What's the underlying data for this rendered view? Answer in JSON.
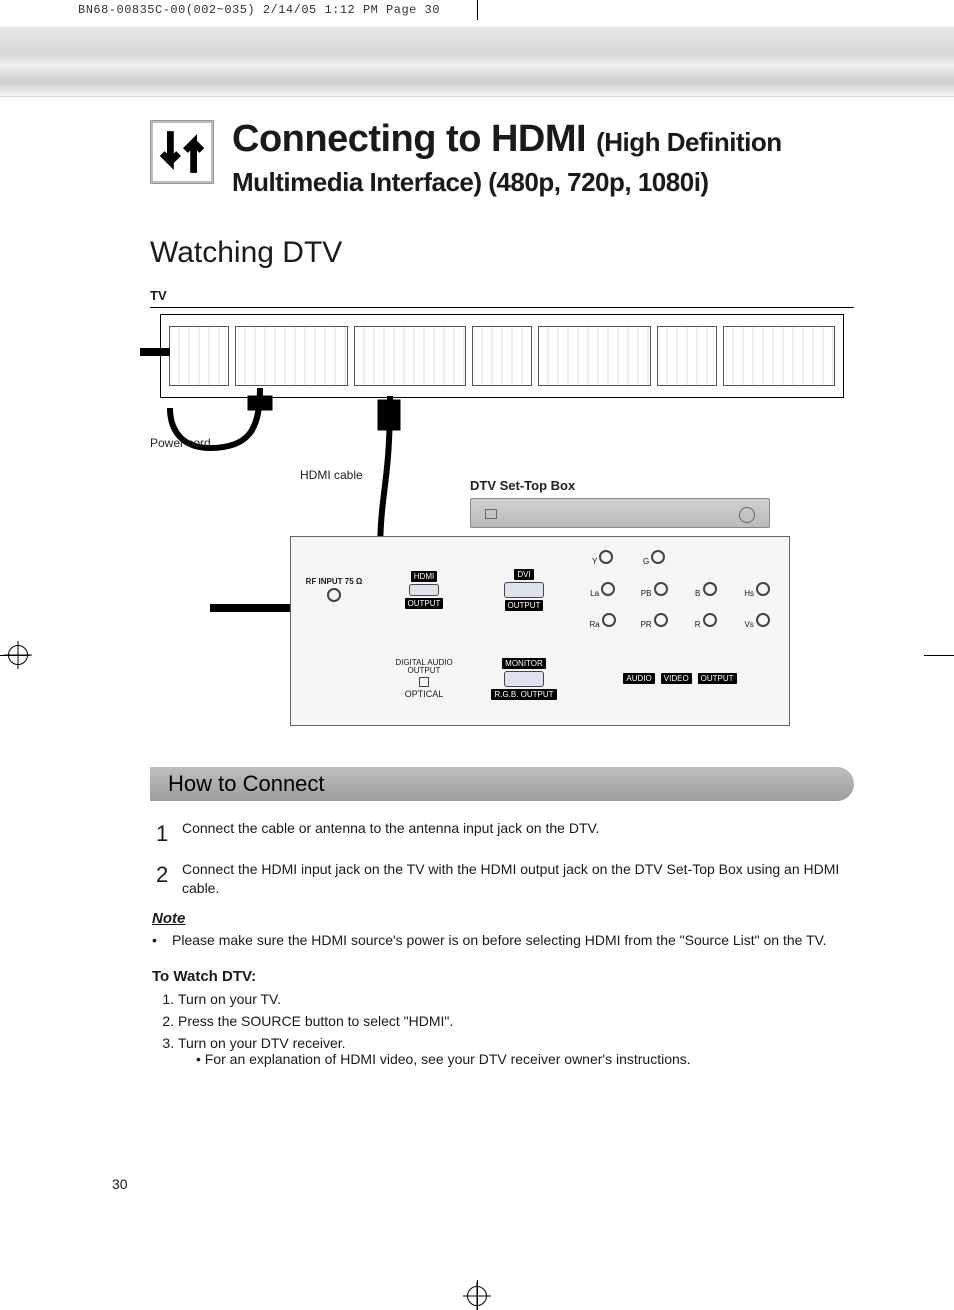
{
  "header_line": "BN68-00835C-00(002~035)  2/14/05  1:12 PM  Page 30",
  "title_main": "Connecting to HDMI",
  "title_sub": "(High Definition Multimedia Interface) (480p, 720p, 1080i)",
  "section_heading": "Watching DTV",
  "labels": {
    "tv": "TV",
    "power_cord": "Power cord",
    "hdmi_cable": "HDMI cable",
    "stb": "DTV Set-Top Box"
  },
  "stb_panel": {
    "rf": "RF INPUT 75 Ω",
    "hdmi": "HDMI",
    "output": "OUTPUT",
    "digital_audio": "DIGITAL AUDIO OUTPUT",
    "optical": "OPTICAL",
    "dvi": "DVI",
    "monitor": "MONITOR",
    "rgb_out": "R.G.B. OUTPUT",
    "audio": "AUDIO",
    "video": "VIDEO",
    "output2": "OUTPUT",
    "jacks": {
      "Y": "Y",
      "Pb": "PB",
      "Pr": "PR",
      "G": "G",
      "B": "B",
      "R": "R",
      "Hs": "Hs",
      "Vs": "Vs",
      "La": "La",
      "Ra": "Ra"
    }
  },
  "how_to_connect": "How to Connect",
  "steps": [
    "Connect the cable or antenna to the antenna input jack on the DTV.",
    "Connect the HDMI input jack on the TV with the HDMI output jack on the DTV Set-Top Box using an HDMI cable."
  ],
  "note_head": "Note",
  "note_body": "Please make sure the HDMI source's power is on before selecting HDMI from the \"Source List\" on the TV.",
  "watch_head": "To Watch DTV:",
  "watch_steps": [
    "Turn on your TV.",
    "Press the SOURCE button to select \"HDMI\".",
    "Turn on your DTV receiver."
  ],
  "watch_sub": "• For an explanation of HDMI video, see your DTV receiver owner's instructions.",
  "page_number": "30"
}
